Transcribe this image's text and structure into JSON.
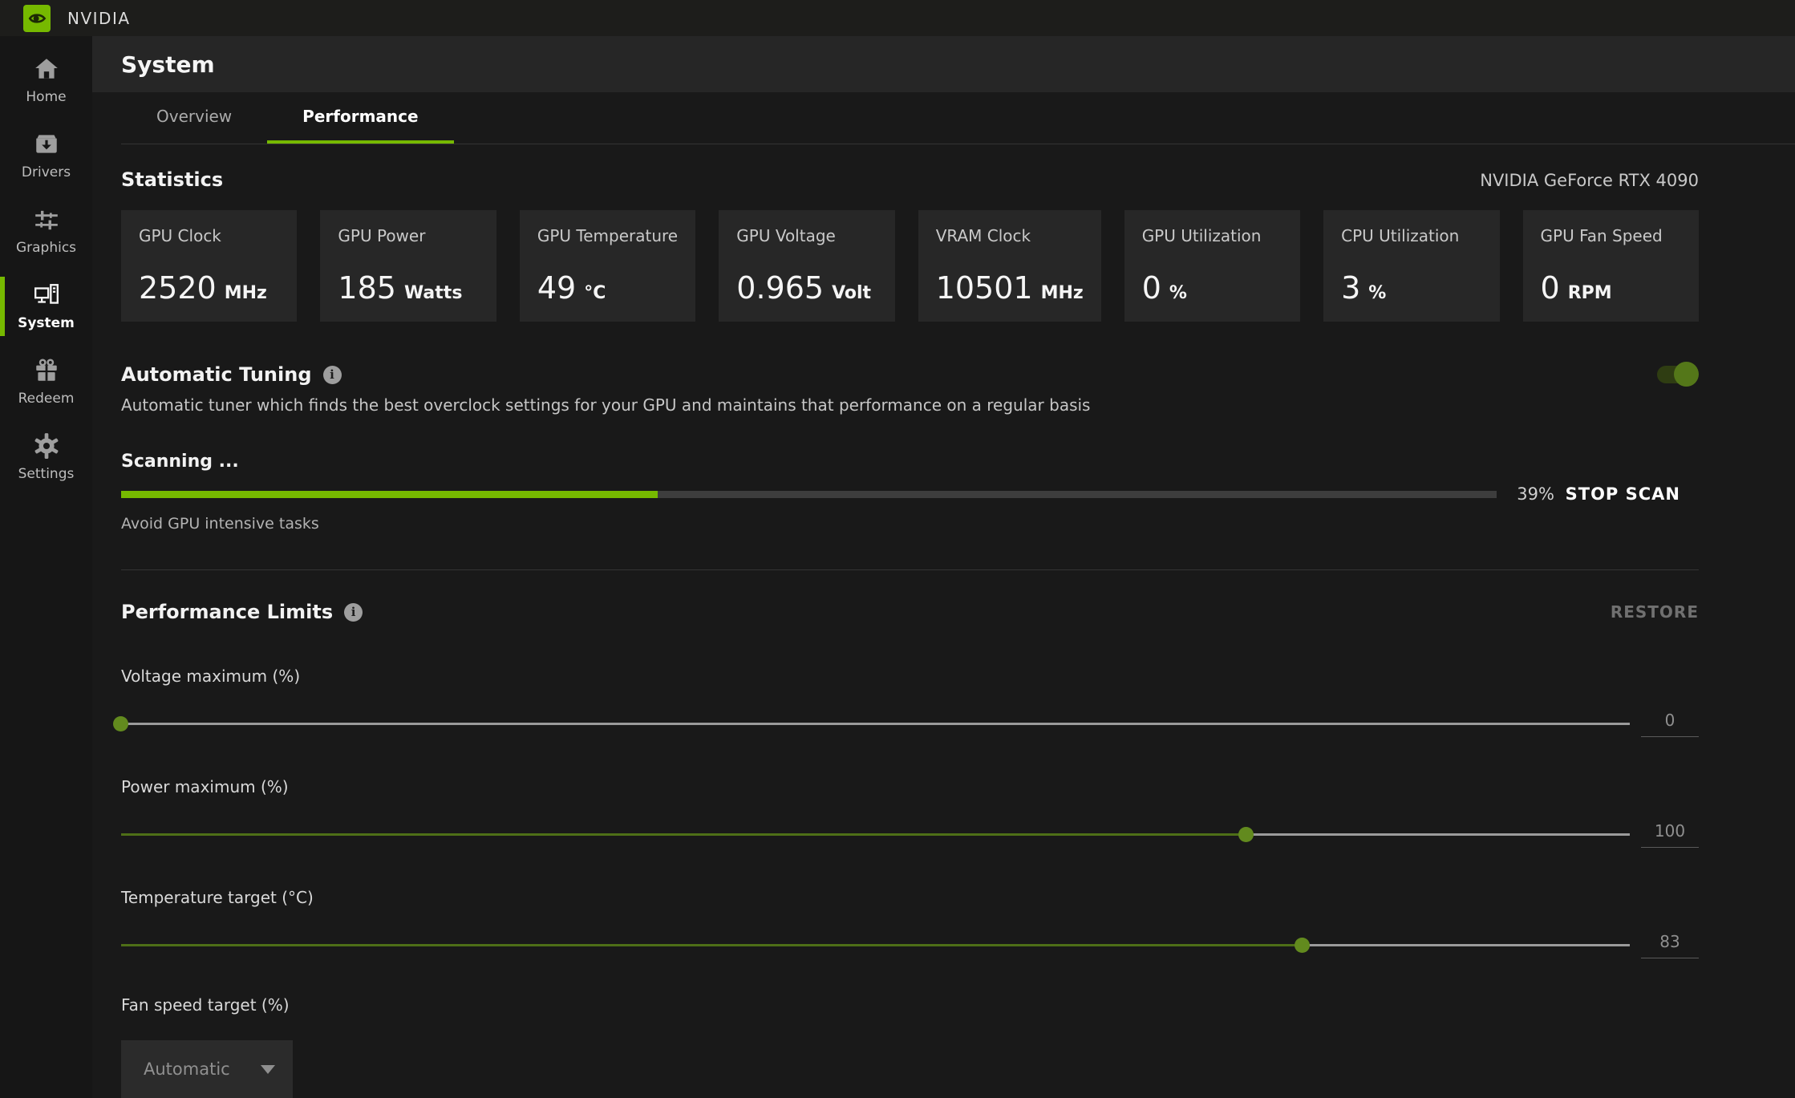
{
  "titlebar": {
    "app_name": "NVIDIA"
  },
  "colors": {
    "accent_green": "#76b900"
  },
  "sidebar": {
    "items": [
      {
        "label": "Home",
        "icon": "home-icon",
        "active": false
      },
      {
        "label": "Drivers",
        "icon": "drivers-icon",
        "active": false
      },
      {
        "label": "Graphics",
        "icon": "graphics-icon",
        "active": false
      },
      {
        "label": "System",
        "icon": "system-icon",
        "active": true
      },
      {
        "label": "Redeem",
        "icon": "redeem-icon",
        "active": false
      },
      {
        "label": "Settings",
        "icon": "settings-icon",
        "active": false
      }
    ]
  },
  "header": {
    "title": "System"
  },
  "tabs": [
    {
      "label": "Overview",
      "active": false
    },
    {
      "label": "Performance",
      "active": true
    }
  ],
  "statistics": {
    "heading": "Statistics",
    "gpu_name": "NVIDIA GeForce RTX 4090",
    "cards": [
      {
        "label": "GPU Clock",
        "value": "2520",
        "unit": "MHz"
      },
      {
        "label": "GPU Power",
        "value": "185",
        "unit": "Watts"
      },
      {
        "label": "GPU Temperature",
        "value": "49",
        "unit": "°C"
      },
      {
        "label": "GPU Voltage",
        "value": "0.965",
        "unit": "Volt"
      },
      {
        "label": "VRAM Clock",
        "value": "10501",
        "unit": "MHz"
      },
      {
        "label": "GPU Utilization",
        "value": "0",
        "unit": "%"
      },
      {
        "label": "CPU Utilization",
        "value": "3",
        "unit": "%"
      },
      {
        "label": "GPU Fan Speed",
        "value": "0",
        "unit": "RPM"
      }
    ]
  },
  "automatic_tuning": {
    "title": "Automatic Tuning",
    "description": "Automatic tuner which finds the best overclock settings for your GPU and maintains that performance on a regular basis",
    "toggle_on": true,
    "scan": {
      "status": "Scanning ...",
      "progress_percent": 39,
      "progress_label": "39%",
      "hint": "Avoid GPU intensive tasks",
      "stop_button": "STOP SCAN"
    }
  },
  "performance_limits": {
    "title": "Performance Limits",
    "restore_button": "RESTORE",
    "sliders": [
      {
        "label": "Voltage maximum (%)",
        "value": "0",
        "knob_percent": 0
      },
      {
        "label": "Power maximum (%)",
        "value": "100",
        "knob_percent": 74.6
      },
      {
        "label": "Temperature target (°C)",
        "value": "83",
        "knob_percent": 78.3
      }
    ],
    "fan": {
      "label": "Fan speed target (%)",
      "selected": "Automatic"
    }
  }
}
